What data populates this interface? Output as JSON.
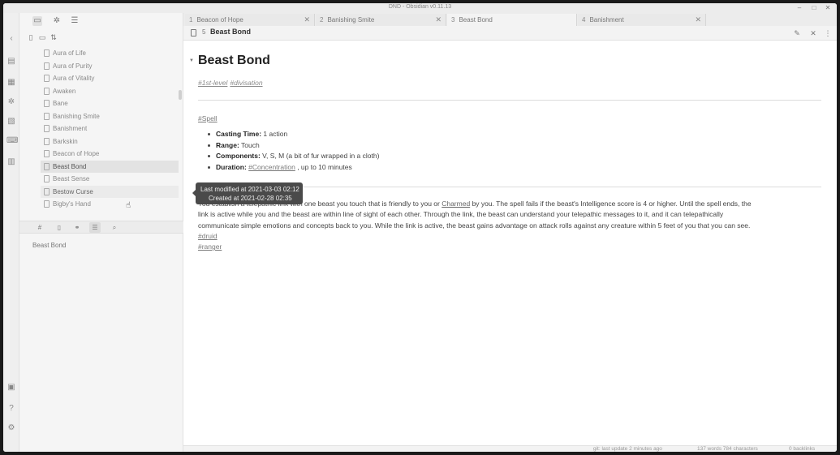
{
  "window": {
    "title": "DND - Obsidian v0.11.13"
  },
  "file_explorer": {
    "files": [
      {
        "label": "Aura of Life",
        "state": ""
      },
      {
        "label": "Aura of Purity",
        "state": ""
      },
      {
        "label": "Aura of Vitality",
        "state": ""
      },
      {
        "label": "Awaken",
        "state": ""
      },
      {
        "label": "Bane",
        "state": ""
      },
      {
        "label": "Banishing Smite",
        "state": ""
      },
      {
        "label": "Banishment",
        "state": ""
      },
      {
        "label": "Barkskin",
        "state": ""
      },
      {
        "label": "Beacon of Hope",
        "state": ""
      },
      {
        "label": "Beast Bond",
        "state": "active"
      },
      {
        "label": "Beast Sense",
        "state": ""
      },
      {
        "label": "Bestow Curse",
        "state": "hover"
      },
      {
        "label": "Bigby's Hand",
        "state": ""
      }
    ]
  },
  "tooltip": {
    "modified": "Last modified at 2021-03-03 02:12",
    "created": "Created at 2021-02-28 02:35"
  },
  "outline": {
    "item": "Beast Bond"
  },
  "tabs": [
    {
      "num": "1",
      "label": "Beacon of Hope"
    },
    {
      "num": "2",
      "label": "Banishing Smite"
    },
    {
      "num": "3",
      "label": "Beast Bond"
    },
    {
      "num": "4",
      "label": "Banishment"
    }
  ],
  "view": {
    "num": "5",
    "title": "Beast Bond"
  },
  "note": {
    "title": "Beast Bond",
    "tags": [
      "#1st-level",
      "#divisation"
    ],
    "spell_tag": "#Spell",
    "casting_time_label": "Casting Time:",
    "casting_time": "1 action",
    "range_label": "Range:",
    "range": "Touch",
    "components_label": "Components:",
    "components": "V, S, M (a bit of fur wrapped in a cloth)",
    "duration_label": "Duration:",
    "duration_link": "#Concentration",
    "duration_rest": ", up to 10 minutes",
    "para1_a": "You establish a telepathic link with one beast you touch that is friendly to you or",
    "para1_link": "Charmed",
    "para1_b": "by you. The spell fails if the beast's Intelligence score is 4 or higher. Until the spell ends, the",
    "para2": "link is active while you and the beast are within line of sight of each other. Through the link, the beast can understand your telepathic messages to it, and it can telepathically",
    "para3": "communicate simple emotions and concepts back to you. While the link is active, the beast gains advantage on attack rolls against any creature within 5 feet of you that you can see.",
    "tag_druid": "#druid",
    "tag_ranger": "#ranger"
  },
  "status": {
    "git": "git: last update 2 minutes ago",
    "counts": "137 words 784 characters",
    "backlinks": "0 backlinks"
  }
}
